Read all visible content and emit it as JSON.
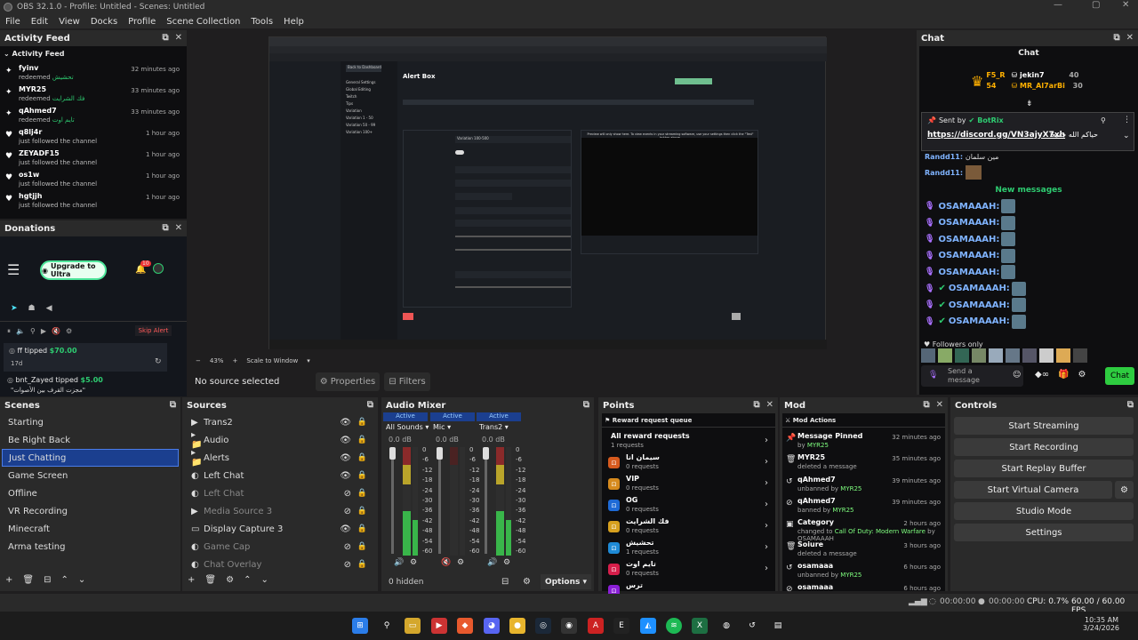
{
  "window": {
    "title": "OBS 32.1.0 - Profile: Untitled - Scenes: Untitled",
    "controls": [
      "—",
      "▢",
      "✕"
    ]
  },
  "menu": [
    "File",
    "Edit",
    "View",
    "Docks",
    "Profile",
    "Scene Collection",
    "Tools",
    "Help"
  ],
  "activity": {
    "dock_title": "Activity Feed",
    "inner_title": "Activity Feed",
    "items": [
      {
        "icon": "star",
        "name": "fyinv",
        "desc": "redeemed",
        "reward": "تحشيش",
        "time": "32 minutes ago"
      },
      {
        "icon": "star",
        "name": "MYR25",
        "desc": "redeemed",
        "reward": "فك الشرايت",
        "time": "33 minutes ago"
      },
      {
        "icon": "star",
        "name": "qAhmed7",
        "desc": "redeemed",
        "reward": "تايم اوت",
        "time": "33 minutes ago"
      },
      {
        "icon": "heart",
        "name": "q8lj4r",
        "desc": "just followed the channel",
        "reward": "",
        "time": "1 hour ago"
      },
      {
        "icon": "heart",
        "name": "ZEYADF15",
        "desc": "just followed the channel",
        "reward": "",
        "time": "1 hour ago"
      },
      {
        "icon": "heart",
        "name": "os1w",
        "desc": "just followed the channel",
        "reward": "",
        "time": "1 hour ago"
      },
      {
        "icon": "heart",
        "name": "hgtjjh",
        "desc": "just followed the channel",
        "reward": "",
        "time": "1 hour ago"
      }
    ]
  },
  "donations": {
    "title": "Donations",
    "upgrade": "Upgrade to Ultra",
    "badge": "10",
    "skip": "Skip Alert",
    "d1_name": "ff tipped",
    "d1_amount": "$70.00",
    "d1_time": "17d",
    "d2_name": "bnt_Zayed tipped",
    "d2_amount": "$5.00",
    "d2_msg": "\"مجزت القرف بين الأصوات\""
  },
  "preview": {
    "zoom": "43%",
    "scale": "Scale to Window",
    "no_source": "No source selected",
    "properties": "Properties",
    "filters": "Filters",
    "inner": {
      "page_title": "Alert Box",
      "back": "Back to Dashboard",
      "nav": [
        "General Settings",
        "Global Editing",
        "Twitch",
        "Tips",
        "Variation",
        "Variation 1 - 50",
        "Variation 50 - 99",
        "Variation 100+"
      ],
      "var_name": "Variation 100-500",
      "preview_text": "Preview will only show here. To view events in your streaming software, use your settings then click the \"Test\" button above."
    }
  },
  "scenes": {
    "title": "Scenes",
    "items": [
      "Starting",
      "Be Right Back",
      "Just Chatting",
      "Game Screen",
      "Offline",
      "VR Recording",
      "Minecraft",
      "Arma testing"
    ],
    "selected": 2
  },
  "sources": {
    "title": "Sources",
    "items": [
      {
        "icon": "▶",
        "label": "Trans2",
        "dim": false,
        "eye": "👁"
      },
      {
        "icon": "▸📁",
        "label": "Audio",
        "dim": false,
        "eye": "👁"
      },
      {
        "icon": "▸📁",
        "label": "Alerts",
        "dim": false,
        "eye": "👁"
      },
      {
        "icon": "◐",
        "label": "Left Chat",
        "dim": false,
        "eye": "👁"
      },
      {
        "icon": "◐",
        "label": "Left Chat",
        "dim": true,
        "eye": "⊘"
      },
      {
        "icon": "▶",
        "label": "Media Source 3",
        "dim": true,
        "eye": "⊘"
      },
      {
        "icon": "▭",
        "label": "Display Capture 3",
        "dim": false,
        "eye": "👁"
      },
      {
        "icon": "◐",
        "label": "Game Cap",
        "dim": true,
        "eye": "⊘"
      },
      {
        "icon": "◐",
        "label": "Chat Overlay",
        "dim": true,
        "eye": "⊘"
      }
    ]
  },
  "mixer": {
    "title": "Audio Mixer",
    "channels": [
      {
        "active": "Active",
        "name": "All Sounds",
        "db": "0.0 dB",
        "level": 0.55
      },
      {
        "active": "Active",
        "name": "Mic",
        "db": "0.0 dB",
        "level": 0.0
      },
      {
        "active": "Active",
        "name": "Trans2",
        "db": "0.0 dB",
        "level": 0.55
      }
    ],
    "ticks": [
      "0",
      "-6",
      "-12",
      "-18",
      "-24",
      "-30",
      "-36",
      "-42",
      "-48",
      "-54",
      "-60"
    ],
    "hidden": "0 hidden",
    "options": "Options"
  },
  "points": {
    "title": "Points",
    "header": "Reward request queue",
    "all": "All reward requests",
    "all_count": "1 requests",
    "items": [
      {
        "name": "سيمان انا",
        "count": "0 requests",
        "color": "#d65a1e"
      },
      {
        "name": "VIP",
        "count": "0 requests",
        "color": "#d68a1e"
      },
      {
        "name": "OG",
        "count": "0 requests",
        "color": "#1e6ad6"
      },
      {
        "name": "فك الشرايت",
        "count": "0 requests",
        "color": "#d6a01e"
      },
      {
        "name": "تحشيش",
        "count": "1 requests",
        "color": "#1e8ad6"
      },
      {
        "name": "تايم اوت",
        "count": "0 requests",
        "color": "#d61e4a"
      },
      {
        "name": "ترس",
        "count": "",
        "color": "#8a1ed6"
      }
    ]
  },
  "mod": {
    "title": "Mod",
    "header": "Mod Actions",
    "items": [
      {
        "icon": "📌",
        "name": "Message Pinned",
        "desc": "by",
        "who": "MYR25",
        "time": "32 minutes ago"
      },
      {
        "icon": "🗑",
        "name": "MYR25",
        "desc": "deleted a message",
        "who": "",
        "time": "35 minutes ago"
      },
      {
        "icon": "↺",
        "name": "qAhmed7",
        "desc": "unbanned by",
        "who": "MYR25",
        "time": "39 minutes ago"
      },
      {
        "icon": "⊘",
        "name": "qAhmed7",
        "desc": "banned by",
        "who": "MYR25",
        "time": "39 minutes ago"
      },
      {
        "icon": "▣",
        "name": "Category",
        "desc": "changed to",
        "who": "Call Of Duty: Modern Warfare",
        "who2": "by OSAMAAAH",
        "time": "2 hours ago"
      },
      {
        "icon": "🗑",
        "name": "Soiure",
        "desc": "deleted a message",
        "who": "",
        "time": "3 hours ago"
      },
      {
        "icon": "↺",
        "name": "osamaaa",
        "desc": "unbanned by",
        "who": "MYR25",
        "time": "6 hours ago"
      },
      {
        "icon": "⊘",
        "name": "osamaaa",
        "desc": "",
        "who": "",
        "time": "6 hours ago"
      }
    ]
  },
  "controls": {
    "title": "Controls",
    "buttons": [
      "Start Streaming",
      "Start Recording",
      "Start Replay Buffer",
      "Start Virtual Camera",
      "Studio Mode",
      "Settings"
    ]
  },
  "chat": {
    "title": "Chat",
    "inner_title": "Chat",
    "top": [
      {
        "name": "F5_R",
        "pts": ""
      },
      {
        "name": "jekin7",
        "pts": "40"
      },
      {
        "name": "",
        "pts": "54"
      },
      {
        "name": "MR_Al7arBi",
        "pts": "30"
      }
    ],
    "pinned_by": "Sent by",
    "pinned_user": "BotRix",
    "pinned_link": "https://discord.gg/VN3ajyX7xh",
    "pinned_msg": "حياكم الله جميعا",
    "m1_user": "Randd11:",
    "m1_text": "مين سلمان",
    "m2_user": "Randd11:",
    "new_messages": "New messages",
    "users": [
      "OSAMAAAH:",
      "OSAMAAAH:",
      "OSAMAAAH:",
      "OSAMAAAH:",
      "OSAMAAAH:",
      "OSAMAAAH:",
      "OSAMAAAH:",
      "OSAMAAAH:"
    ],
    "followers_only": "Followers only",
    "send_placeholder": "Send a message",
    "chat_btn": "Chat"
  },
  "status": {
    "t1": "00:00:00",
    "t2": "00:00:00",
    "cpu": "CPU: 0.7%",
    "fps": "60.00 / 60.00 FPS"
  },
  "taskbar": {
    "time": "10:35 AM",
    "date": "3/24/2026"
  }
}
